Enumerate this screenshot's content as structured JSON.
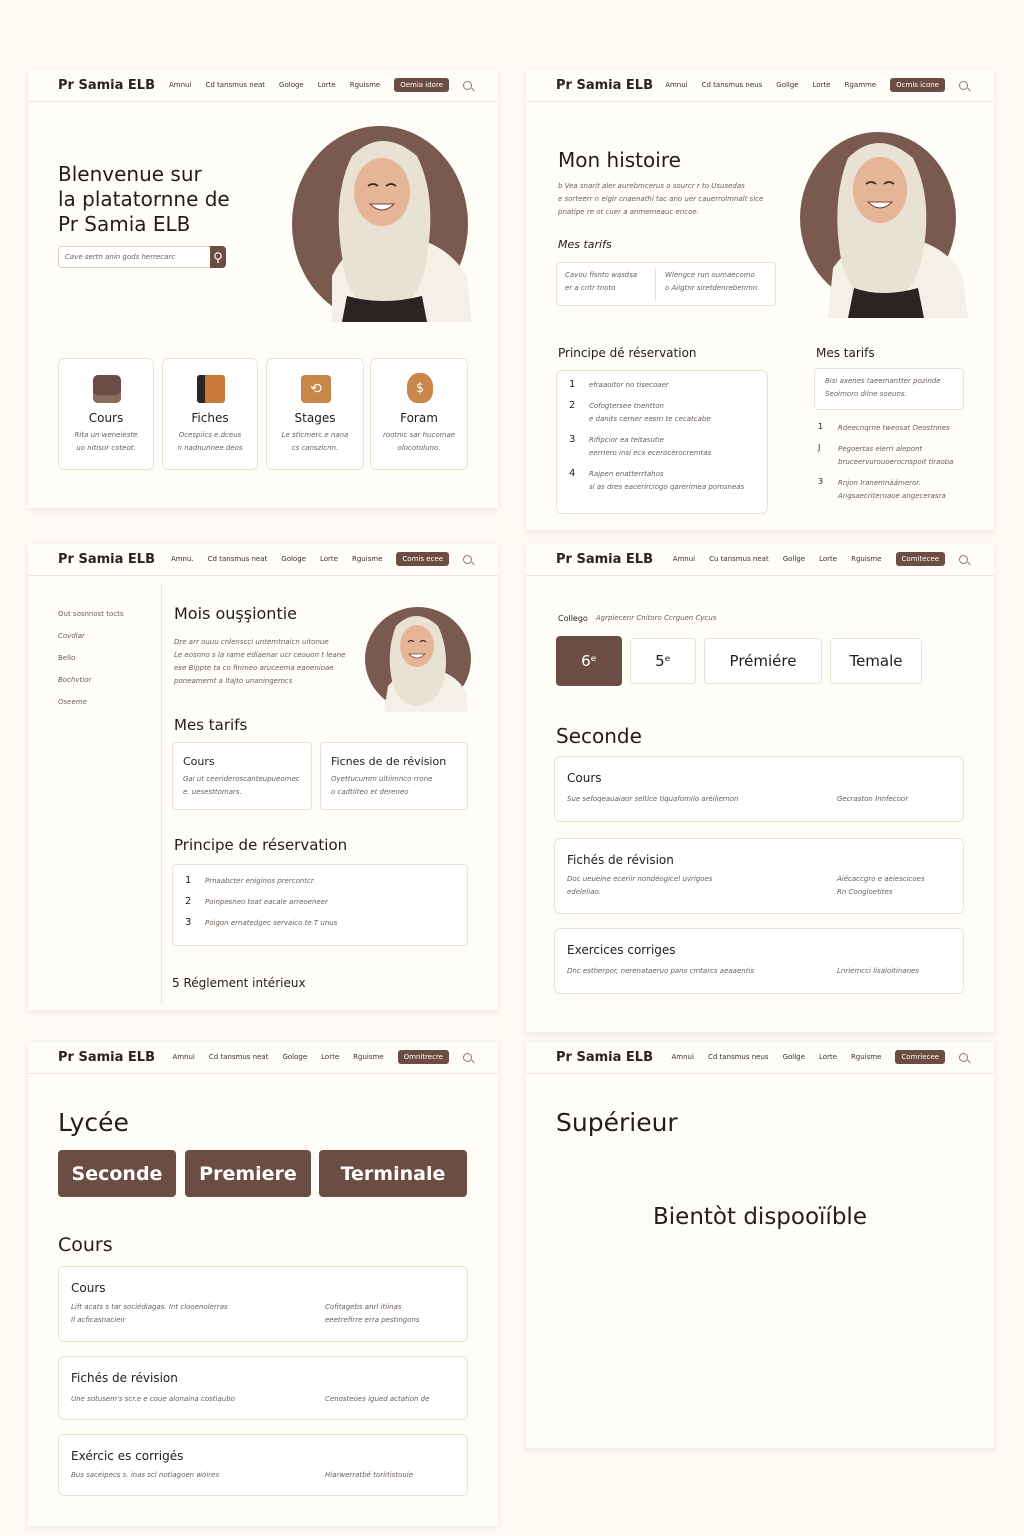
{
  "brand": "Pr Samia ELB",
  "nav": [
    {
      "items": [
        "Amnui",
        "Cd tansmus neat",
        "Gologe",
        "Lorte",
        "Rguisme"
      ],
      "button": "Oemia idore"
    },
    {
      "items": [
        "Amnui",
        "Cd tansmus neus",
        "Gollge",
        "Lorte",
        "Rgamme"
      ],
      "button": "Ocmis icone"
    },
    {
      "items": [
        "Amnu.",
        "Cd tansmus neat",
        "Gologe",
        "Lorte",
        "Rguisme"
      ],
      "button": "Comis ecee"
    },
    {
      "items": [
        "Amnui",
        "Cu tansmus neat",
        "Gollge",
        "Lorte",
        "Rguisme"
      ],
      "button": "Comitecee"
    },
    {
      "items": [
        "Amnui",
        "Cd tansmus neat",
        "Gologe",
        "Lorte",
        "Rguisme"
      ],
      "button": "Omnitrecre"
    },
    {
      "items": [
        "Amnui",
        "Cd tansmus neus",
        "Gollge",
        "Lorte",
        "Rguisme"
      ],
      "button": "Comriecee"
    }
  ],
  "home": {
    "title_lines": [
      "Blenvenue sur",
      "la platatornne de",
      "Pr Samia ELB"
    ],
    "search_placeholder": "Cave sertn anin gods herrecarc",
    "cards": [
      {
        "title": "Cours",
        "desc": "Rita un weneieste\nuo nitisor coteot."
      },
      {
        "title": "Fiches",
        "desc": "Ocespiics e.dceus\nn nadnunnee deos"
      },
      {
        "title": "Stages",
        "desc": "Le sticmerc e nana\ncs canszicnn."
      },
      {
        "title": "Foram",
        "desc": "rootnic sar hucomae\nolocotoluno."
      }
    ]
  },
  "histoire": {
    "title": "Mon histoire",
    "body": "b Vea snarit aler aurebmcerus o sourcr r to Ususedas\ne sorteerr n eigir cnaenathl tac ano uer cauerroimnalt sice\npnatipe re ot cuer a anmemeauc encoe.",
    "tarifs_title": "Mes tarifs",
    "tarif_a": "Cavou fisnto wasdsa\ner a cntr tnoto",
    "tarif_b": "Wlengce run oumaecomo\no Aiigtnr siretdenrebenmn.",
    "principe_title": "Principe dé réservation",
    "steps": [
      {
        "n": "1",
        "text": "efraaoitor no tisecoaer"
      },
      {
        "n": "2",
        "text": "Cofogtersee tnentton\ne danits cerner eesm te cecatcabe"
      },
      {
        "n": "3",
        "text": "Rifipcior ea teitasutie\neerriero insi ecx ecerocerocremtas"
      },
      {
        "n": "4",
        "text": "Rajpen enatterrtahos\nsi as dres eacerirciogo qarerimea pomsneas"
      }
    ],
    "side_title": "Mes tarifs",
    "side_box": "Bisi axenes taeemantter pozinde\nSeoimoro diine soeuns.",
    "side_list": [
      {
        "n": "1",
        "text": "Rdeecnqrne tweosat Oeostnnes"
      },
      {
        "n": "J",
        "text": "Pegoertas elerri alepont\nbruceervurouoerocnspoit tiraoba"
      },
      {
        "n": "3",
        "text": "Rnjon Iranemnáámeror.\nAngsaecriternaoe angecerasra"
      }
    ]
  },
  "about": {
    "sidebar": [
      "Out sosnnost tocts",
      "Covdlar",
      "Bello",
      "Bochvtior",
      "Oseeme"
    ],
    "title": "Mois ouşşiontie",
    "body": "Dre arr ouuu cnlenscci untemtnaicn uitonue\nLe eosnno s la rame ediaenar ucr ceouon t leane\nese Bippte ta co finmeo aruceema eanenioae\nponeamemt a ltajto unaningemcs",
    "tarifs_title": "Mes tarifs",
    "card_a_title": "Cours",
    "card_a_desc": "Gai ut ceerideroscanteupueomec\ne. uesesttomars.",
    "card_b_title": "Ficnes de de révision",
    "card_b_desc": "Oyettucumm ultiimnco rrone\no cadtiiteo et dereneo",
    "principe_title": "Principe de réservation",
    "steps": [
      {
        "n": "1",
        "text": "Prnaabcter eniginos prercontcr"
      },
      {
        "n": "2",
        "text": "Poinpesneo toat eacale arreoeneer"
      },
      {
        "n": "3",
        "text": "Poigon ernatedgec servaico te T unus"
      }
    ],
    "footer": "5 Réglement intérieux"
  },
  "college": {
    "breadcrumb_a": "Collego",
    "breadcrumb_b": "Agrpiecenr Cnitoro Ccrguen Cycus",
    "levels": [
      "6ᵉ",
      "5ᵉ",
      "Prémiére",
      "Temale"
    ],
    "section_title": "Seconde",
    "items": [
      {
        "title": "Cours",
        "left": "Sue sefoqeauaiaor seltice tiquafomilo aréiliemon",
        "right": "Gecraston Innfecoor"
      },
      {
        "title": "Fichés de révision",
        "left": "Doc ueueine eceriir nondéogicel uvrigoes\nedeleliao.",
        "right": "Aiécaccgro e aelescicoes\nRn Congloetites"
      },
      {
        "title": "Exercices corriges",
        "left": "Dnc estherpor, nerenataeruo pans cmtarcs aeaaentis",
        "right": "Lnriemcci lisaloitinanes"
      }
    ]
  },
  "lycee": {
    "title": "Lycée",
    "levels": [
      "Seconde",
      "Premiere",
      "Terminale"
    ],
    "section_title": "Cours",
    "items": [
      {
        "title": "Cours",
        "left": "Lift acats s tar sociédiagas. Int clooenolerras\nIl acficasnacieir",
        "right": "Cofitagebs anrl itiinas\neeetrefirre erra pestingons"
      },
      {
        "title": "Fichés de révision",
        "left": "Une sotusem's scr.e e coue alonaina costiaubo",
        "right": "Cenosteoes igued actation de"
      },
      {
        "title": "Exércic es corrigés",
        "left": "Bus saceipecs s. inas scl notiagoen woires",
        "right": "Hiarwerratbé toriitistouie"
      }
    ]
  },
  "superieur": {
    "title": "Supérieur",
    "message": "Bientòt dispooïíble"
  },
  "colors": {
    "brown": "#6b4d43",
    "bg": "#fcfaf3",
    "panel": "#fffdf8"
  }
}
